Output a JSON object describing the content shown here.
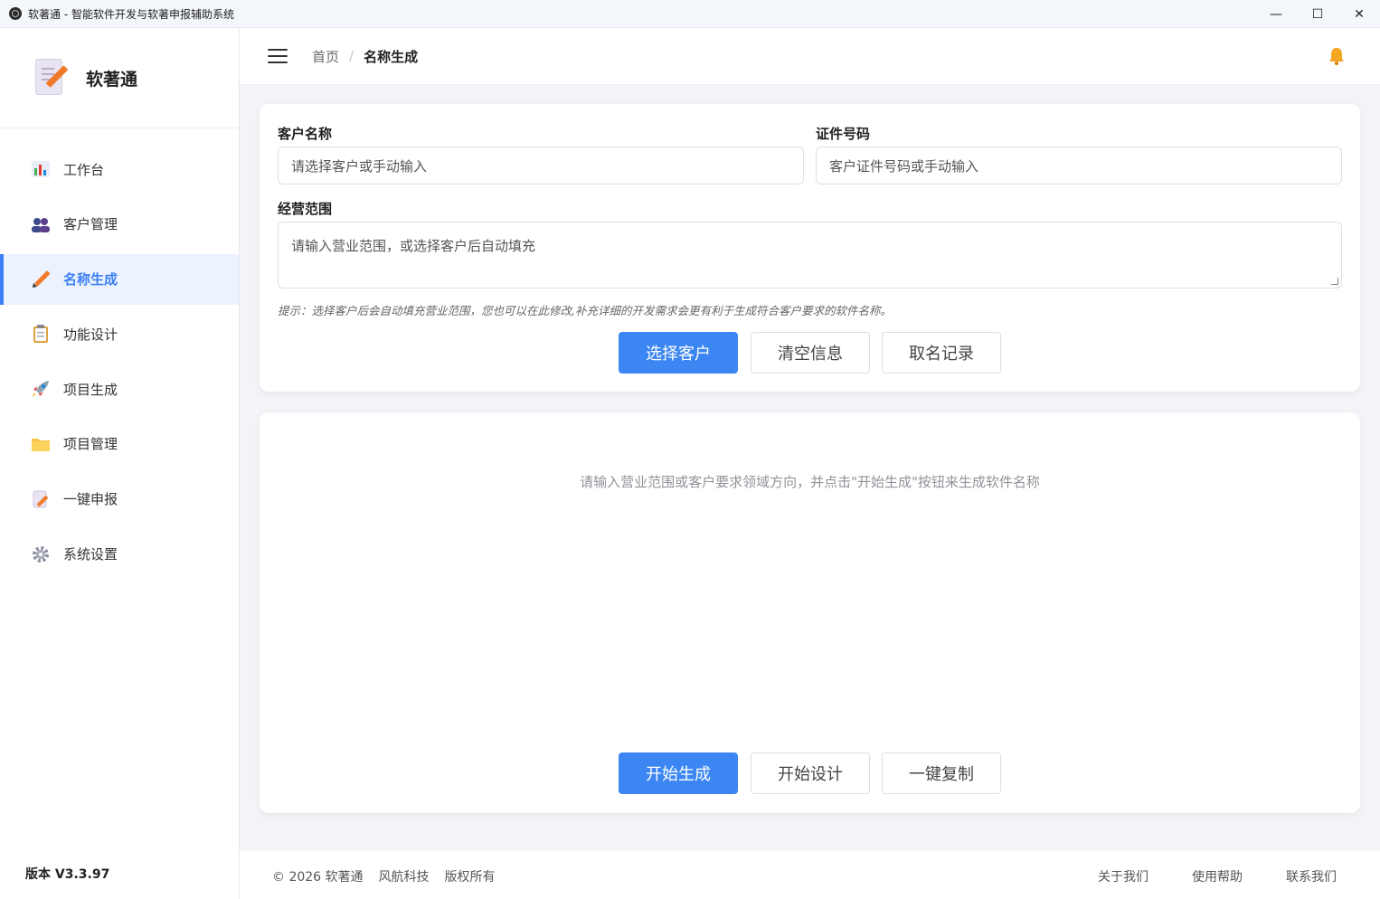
{
  "window": {
    "title": "软著通 - 智能软件开发与软著申报辅助系统",
    "minimize": "—",
    "maximize": "☐",
    "close": "✕"
  },
  "sidebar": {
    "logo_text": "软著通",
    "items": [
      {
        "label": "工作台",
        "icon": "chart-icon"
      },
      {
        "label": "客户管理",
        "icon": "users-icon"
      },
      {
        "label": "名称生成",
        "icon": "pencil-icon",
        "active": true
      },
      {
        "label": "功能设计",
        "icon": "clipboard-icon"
      },
      {
        "label": "项目生成",
        "icon": "rocket-icon"
      },
      {
        "label": "项目管理",
        "icon": "folder-icon"
      },
      {
        "label": "一键申报",
        "icon": "document-edit-icon"
      },
      {
        "label": "系统设置",
        "icon": "gear-icon"
      }
    ],
    "version": "版本 V3.3.97"
  },
  "header": {
    "breadcrumb_home": "首页",
    "breadcrumb_sep": "/",
    "breadcrumb_current": "名称生成"
  },
  "form": {
    "customer_label": "客户名称",
    "customer_placeholder": "请选择客户或手动输入",
    "cert_label": "证件号码",
    "cert_placeholder": "客户证件号码或手动输入",
    "scope_label": "经营范围",
    "scope_placeholder": "请输入营业范围，或选择客户后自动填充",
    "hint": "提示：选择客户后会自动填充营业范围，您也可以在此修改,补充详细的开发需求会更有利于生成符合客户要求的软件名称。",
    "btn_select": "选择客户",
    "btn_clear": "清空信息",
    "btn_records": "取名记录"
  },
  "result": {
    "empty_message": "请输入营业范围或客户要求领域方向，并点击\"开始生成\"按钮来生成软件名称",
    "btn_generate": "开始生成",
    "btn_design": "开始设计",
    "btn_copy": "一键复制"
  },
  "footer": {
    "copyright": "© 2026 软著通",
    "company": "风航科技",
    "rights": "版权所有",
    "about": "关于我们",
    "help": "使用帮助",
    "contact": "联系我们"
  }
}
